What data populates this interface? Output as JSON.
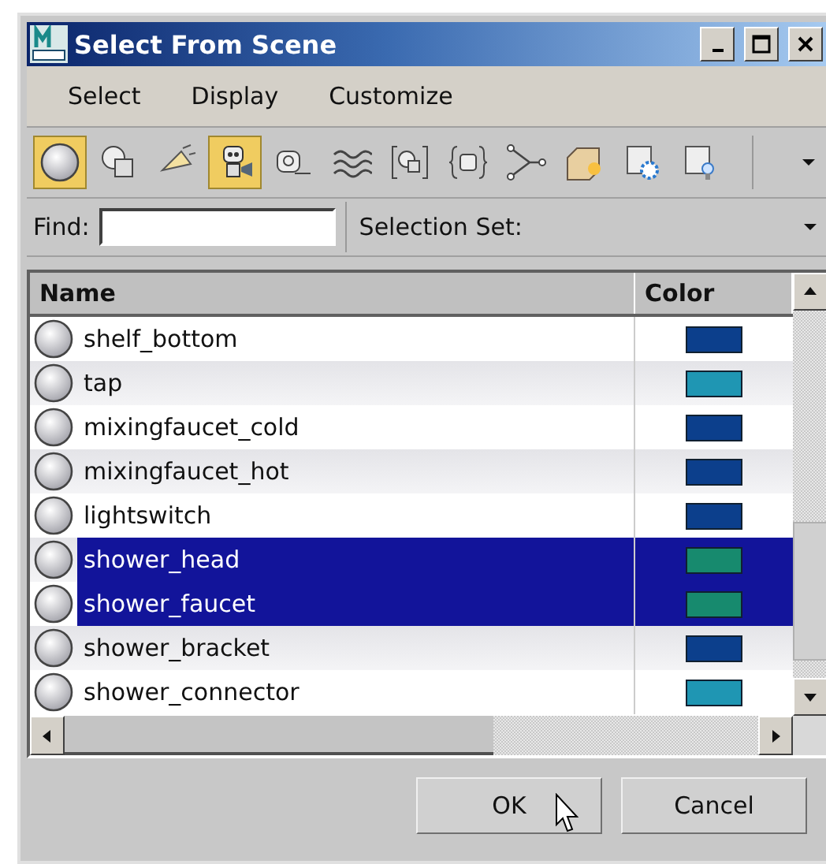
{
  "window": {
    "title": "Select From Scene"
  },
  "menu": [
    "Select",
    "Display",
    "Customize"
  ],
  "toolbar": [
    {
      "kind": "sphere",
      "selected": true
    },
    {
      "kind": "shapes",
      "selected": false
    },
    {
      "kind": "lamp",
      "selected": false
    },
    {
      "kind": "robot",
      "selected": true
    },
    {
      "kind": "tape",
      "selected": false
    },
    {
      "kind": "waves",
      "selected": false
    },
    {
      "kind": "bracketed",
      "selected": false
    },
    {
      "kind": "braces",
      "selected": false
    },
    {
      "kind": "branch",
      "selected": false
    },
    {
      "kind": "box",
      "selected": false
    },
    {
      "kind": "gearpage",
      "selected": false
    },
    {
      "kind": "bulbpage",
      "selected": false
    }
  ],
  "find": {
    "label": "Find:"
  },
  "selection_set": {
    "label": "Selection Set:"
  },
  "table": {
    "columns": [
      "Name",
      "Color"
    ],
    "rows": [
      {
        "name": "shelf_bottom",
        "color": "#0c3f8c",
        "selected": false
      },
      {
        "name": "tap",
        "color": "#1f96b3",
        "selected": false
      },
      {
        "name": "mixingfaucet_cold",
        "color": "#0c3f8c",
        "selected": false
      },
      {
        "name": "mixingfaucet_hot",
        "color": "#0c3f8c",
        "selected": false
      },
      {
        "name": "lightswitch",
        "color": "#0c3f8c",
        "selected": false
      },
      {
        "name": "shower_head",
        "color": "#178a6e",
        "selected": true
      },
      {
        "name": "shower_faucet",
        "color": "#178a6e",
        "selected": true
      },
      {
        "name": "shower_bracket",
        "color": "#0c3f8c",
        "selected": false
      },
      {
        "name": "shower_connector",
        "color": "#1f96b3",
        "selected": false
      }
    ]
  },
  "buttons": [
    "OK",
    "Cancel"
  ]
}
